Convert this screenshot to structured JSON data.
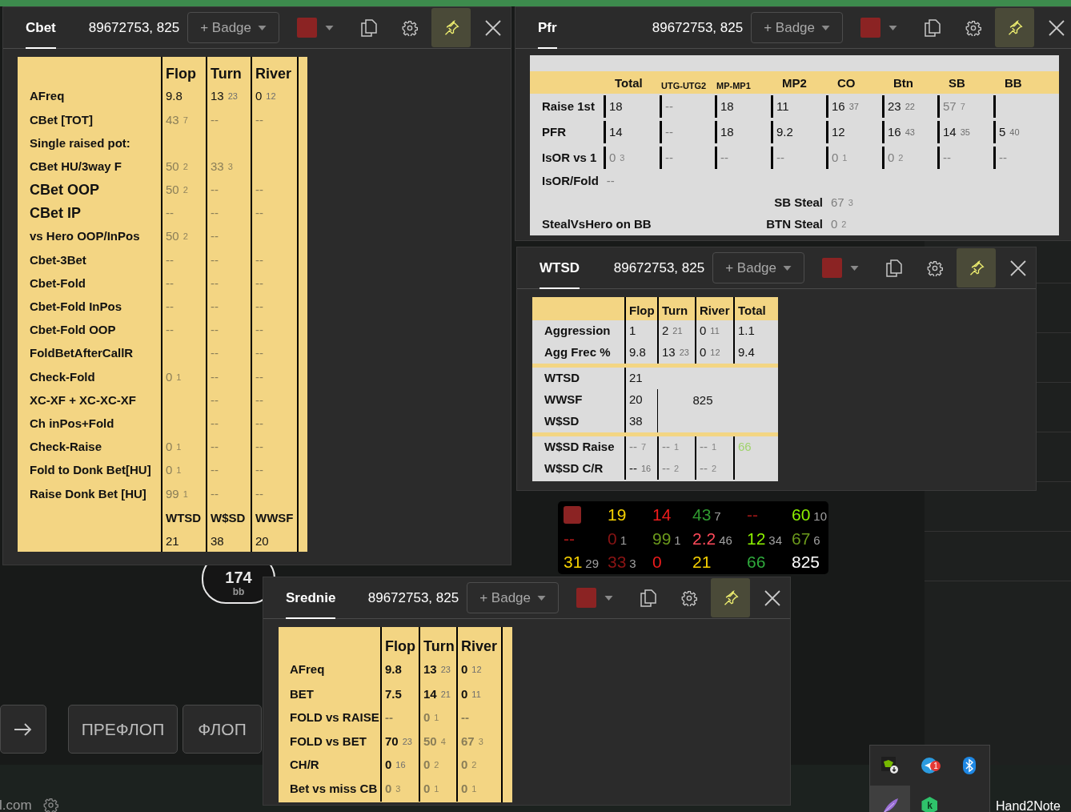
{
  "background": {
    "pot": {
      "value": "174",
      "unit": "bb"
    },
    "nav_buttons": [
      {
        "kind": "arrow"
      },
      {
        "kind": "text",
        "label": "ПРЕФЛОП"
      },
      {
        "kind": "text",
        "label": "ФЛОП"
      }
    ],
    "footer_text": "l.com"
  },
  "popups": [
    {
      "kind": "streets",
      "tab": {
        "label": "Cbet",
        "selected": true
      },
      "player": "89672753, 825",
      "badge_button": "+ Badge",
      "color": "#8b2323",
      "pinned": true,
      "columns": [
        "Flop",
        "Turn",
        "River"
      ],
      "rows": [
        {
          "label": "AFreq",
          "big": false,
          "cells": [
            {
              "v": "9.8",
              "dim": false
            },
            {
              "v": "13",
              "n": "23",
              "dim": false
            },
            {
              "v": "0",
              "n": "12",
              "dim": false
            }
          ]
        },
        {
          "label": "CBet [TOT]",
          "big": false,
          "cells": [
            {
              "v": "43",
              "n": "7",
              "dim": true
            },
            {
              "v": "--",
              "dim": true
            },
            {
              "v": "--",
              "dim": true
            }
          ]
        },
        {
          "label": "Single raised pot:",
          "big": false,
          "cells": [
            null,
            null,
            null
          ]
        },
        {
          "label": "CBet HU/3way F",
          "big": false,
          "cells": [
            {
              "v": "50",
              "n": "2",
              "dim": true
            },
            {
              "v": "33",
              "n": "3",
              "dim": true
            },
            null
          ]
        },
        {
          "label": "CBet OOP",
          "big": true,
          "cells": [
            {
              "v": "50",
              "n": "2",
              "dim": true
            },
            {
              "v": "--",
              "dim": true
            },
            {
              "v": "--",
              "dim": true
            }
          ]
        },
        {
          "label": "CBet IP",
          "big": true,
          "cells": [
            {
              "v": "--",
              "dim": true
            },
            {
              "v": "--",
              "dim": true
            },
            {
              "v": "--",
              "dim": true
            }
          ]
        },
        {
          "label": "vs Hero OOP/InPos",
          "big": false,
          "cells": [
            {
              "v": "50",
              "n": "2",
              "dim": true
            },
            {
              "v": "--",
              "dim": true
            },
            null
          ]
        },
        {
          "label": "Cbet-3Bet",
          "big": false,
          "cells": [
            {
              "v": "--",
              "dim": true
            },
            {
              "v": "--",
              "dim": true
            },
            {
              "v": "--",
              "dim": true
            }
          ]
        },
        {
          "label": "Cbet-Fold",
          "big": false,
          "cells": [
            {
              "v": "--",
              "dim": true
            },
            {
              "v": "--",
              "dim": true
            },
            {
              "v": "--",
              "dim": true
            }
          ]
        },
        {
          "label": "Cbet-Fold InPos",
          "big": false,
          "cells": [
            {
              "v": "--",
              "dim": true
            },
            {
              "v": "--",
              "dim": true
            },
            {
              "v": "--",
              "dim": true
            }
          ]
        },
        {
          "label": "Cbet-Fold OOP",
          "big": false,
          "cells": [
            {
              "v": "--",
              "dim": true
            },
            {
              "v": "--",
              "dim": true
            },
            {
              "v": "--",
              "dim": true
            }
          ]
        },
        {
          "label": "FoldBetAfterCallR",
          "big": false,
          "cells": [
            null,
            {
              "v": "--",
              "dim": true
            },
            {
              "v": "--",
              "dim": true
            }
          ]
        },
        {
          "label": "Check-Fold",
          "big": false,
          "cells": [
            {
              "v": "0",
              "n": "1",
              "dim": true
            },
            {
              "v": "--",
              "dim": true
            },
            {
              "v": "--",
              "dim": true
            }
          ]
        },
        {
          "label": "XC-XF + XC-XC-XF",
          "big": false,
          "cells": [
            null,
            {
              "v": "--",
              "dim": true
            },
            {
              "v": "--",
              "dim": true
            }
          ]
        },
        {
          "label": "Ch inPos+Fold",
          "big": false,
          "cells": [
            null,
            {
              "v": "--",
              "dim": true
            },
            {
              "v": "--",
              "dim": true
            }
          ]
        },
        {
          "label": "Check-Raise",
          "big": false,
          "cells": [
            {
              "v": "0",
              "n": "1",
              "dim": true
            },
            {
              "v": "--",
              "dim": true
            },
            {
              "v": "--",
              "dim": true
            }
          ]
        },
        {
          "label": "Fold to Donk Bet[HU]",
          "big": false,
          "cells": [
            {
              "v": "0",
              "n": "1",
              "dim": true
            },
            {
              "v": "--",
              "dim": true
            },
            {
              "v": "--",
              "dim": true
            }
          ]
        },
        {
          "label": "Raise Donk Bet [HU]",
          "big": false,
          "cells": [
            {
              "v": "99",
              "n": "1",
              "dim": true
            },
            {
              "v": "--",
              "dim": true
            },
            {
              "v": "--",
              "dim": true
            }
          ]
        }
      ],
      "footer": {
        "headers": [
          "WTSD",
          "W$SD",
          "WWSF"
        ],
        "values": [
          "21",
          "38",
          "20"
        ]
      }
    },
    {
      "kind": "positions",
      "tab": {
        "label": "Pfr",
        "selected": true
      },
      "player": "89672753, 825",
      "badge_button": "+ Badge",
      "color": "#8b2323",
      "pinned": true,
      "columns": [
        {
          "label": "Total",
          "small": false
        },
        {
          "label": "UTG-UTG2",
          "small": true
        },
        {
          "label": "MP-MP1",
          "small": true
        },
        {
          "label": "MP2",
          "small": false
        },
        {
          "label": "CO",
          "small": false
        },
        {
          "label": "Btn",
          "small": false
        },
        {
          "label": "SB",
          "small": false
        },
        {
          "label": "BB",
          "small": false
        }
      ],
      "rows": [
        {
          "label": "Raise 1st",
          "cells": [
            {
              "v": "18",
              "dim": false
            },
            {
              "v": "--",
              "dim": true
            },
            {
              "v": "18",
              "dim": false
            },
            {
              "v": "11",
              "dim": false
            },
            {
              "v": "16",
              "n": "37",
              "dim": false
            },
            {
              "v": "23",
              "n": "22",
              "dim": false
            },
            {
              "v": "57",
              "n": "7",
              "dim": true
            },
            null
          ]
        },
        {
          "label": "PFR",
          "cells": [
            {
              "v": "14",
              "dim": false
            },
            {
              "v": "--",
              "dim": true
            },
            {
              "v": "18",
              "dim": false
            },
            {
              "v": "9.2",
              "dim": false
            },
            {
              "v": "12",
              "dim": false
            },
            {
              "v": "16",
              "n": "43",
              "dim": false
            },
            {
              "v": "14",
              "n": "35",
              "dim": false
            },
            {
              "v": "5",
              "n": "40",
              "dim": false
            }
          ]
        },
        {
          "label": "IsOR vs 1",
          "cells": [
            {
              "v": "0",
              "n": "3",
              "dim": true
            },
            {
              "v": "--",
              "dim": true
            },
            {
              "v": "--",
              "dim": true
            },
            {
              "v": "--",
              "dim": true
            },
            {
              "v": "0",
              "n": "1",
              "dim": true
            },
            {
              "v": "0",
              "n": "2",
              "dim": true
            },
            {
              "v": "--",
              "dim": true
            },
            {
              "v": "--",
              "dim": true
            }
          ]
        }
      ],
      "extra_lines": [
        {
          "left": {
            "label": "IsOR/Fold",
            "cell": {
              "v": "--",
              "dim": true
            }
          }
        },
        {
          "right": {
            "label": "SB Steal",
            "cell": {
              "v": "67",
              "n": "3",
              "dim": true
            }
          }
        },
        {
          "left": {
            "label": "StealVsHero on BB"
          },
          "right": {
            "label": "BTN Steal",
            "cell": {
              "v": "0",
              "n": "2",
              "dim": true
            }
          }
        }
      ]
    },
    {
      "kind": "showdown",
      "tab": {
        "label": "WTSD",
        "selected": true
      },
      "player": "89672753, 825",
      "badge_button": "+ Badge",
      "color": "#8b2323",
      "pinned": true,
      "columns": [
        "Flop",
        "Turn",
        "River",
        "Total"
      ],
      "sections": [
        {
          "kind": "grid",
          "rows": [
            {
              "label": "Aggression",
              "cells": [
                {
                  "v": "1",
                  "dim": false
                },
                {
                  "v": "2",
                  "n": "21",
                  "dim": false
                },
                {
                  "v": "0",
                  "n": "11",
                  "dim": false
                },
                {
                  "v": "1.1",
                  "dim": false
                }
              ]
            },
            {
              "label": "Agg Frec %",
              "cells": [
                {
                  "v": "9.8",
                  "dim": false
                },
                {
                  "v": "13",
                  "n": "23",
                  "dim": false
                },
                {
                  "v": "0",
                  "n": "12",
                  "dim": false
                },
                {
                  "v": "9.4",
                  "dim": false
                }
              ]
            }
          ]
        },
        {
          "kind": "summary",
          "rows": [
            {
              "label": "WTSD",
              "cells": [
                {
                  "v": "21",
                  "dim": false
                }
              ]
            },
            {
              "label": "WWSF",
              "cells": [
                {
                  "v": "20",
                  "dim": false
                }
              ],
              "note": "825"
            },
            {
              "label": "W$SD",
              "cells": [
                {
                  "v": "38",
                  "dim": false
                }
              ]
            }
          ]
        },
        {
          "kind": "grid",
          "rows": [
            {
              "label": "W$SD Raise",
              "cells": [
                {
                  "v": "--",
                  "n": "7",
                  "dim": true
                },
                {
                  "v": "--",
                  "n": "1",
                  "dim": true
                },
                {
                  "v": "--",
                  "n": "1",
                  "dim": true
                },
                {
                  "v": "66",
                  "color": "#9fd36c"
                }
              ]
            },
            {
              "label": "W$SD C/R",
              "cells": [
                {
                  "v": "--",
                  "n": "16",
                  "dim": false
                },
                {
                  "v": "--",
                  "n": "2",
                  "dim": true
                },
                {
                  "v": "--",
                  "n": "2",
                  "dim": true
                },
                null
              ]
            }
          ]
        }
      ]
    },
    {
      "kind": "streets_bold",
      "tab": {
        "label": "Srednie",
        "selected": true
      },
      "player": "89672753, 825",
      "badge_button": "+ Badge",
      "color": "#8b2323",
      "pinned": true,
      "columns": [
        "Flop",
        "Turn",
        "River"
      ],
      "rows": [
        {
          "label": "AFreq",
          "cells": [
            {
              "v": "9.8",
              "dim": false
            },
            {
              "v": "13",
              "n": "23",
              "dim": false
            },
            {
              "v": "0",
              "n": "12",
              "dim": false
            }
          ]
        },
        {
          "label": "BET",
          "cells": [
            {
              "v": "7.5",
              "dim": false
            },
            {
              "v": "14",
              "n": "21",
              "dim": false
            },
            {
              "v": "0",
              "n": "11",
              "dim": false
            }
          ]
        },
        {
          "label": "FOLD vs RAISE",
          "cells": [
            {
              "v": "--",
              "dim": true
            },
            {
              "v": "0",
              "n": "1",
              "dim": true
            },
            {
              "v": "--",
              "dim": true
            }
          ]
        },
        {
          "label": "FOLD vs BET",
          "cells": [
            {
              "v": "70",
              "n": "23",
              "dim": false
            },
            {
              "v": "50",
              "n": "4",
              "dim": true
            },
            {
              "v": "67",
              "n": "3",
              "dim": true
            }
          ]
        },
        {
          "label": "CH/R",
          "cells": [
            {
              "v": "0",
              "n": "16",
              "dim": false
            },
            {
              "v": "0",
              "n": "2",
              "dim": true
            },
            {
              "v": "0",
              "n": "2",
              "dim": true
            }
          ]
        },
        {
          "label": "Bet vs miss CB",
          "cells": [
            {
              "v": "0",
              "n": "3",
              "dim": true
            },
            {
              "v": "0",
              "n": "1",
              "dim": true
            },
            {
              "v": "0",
              "n": "1",
              "dim": true
            }
          ]
        }
      ]
    }
  ],
  "hud": {
    "rows": [
      [
        {
          "kind": "swatch",
          "color": "#8b2323"
        },
        {
          "kind": "stat",
          "v": "19",
          "color": "#f5d000"
        },
        {
          "kind": "stat",
          "v": "14",
          "color": "#ee1c1c"
        },
        {
          "kind": "stat",
          "v": "43",
          "n": "7",
          "color": "#2f9a2f"
        },
        {
          "kind": "stat",
          "v": "--",
          "color": "#a01818"
        },
        {
          "kind": "stat",
          "v": "60",
          "n": "10",
          "color": "#8cf000"
        }
      ],
      [
        {
          "kind": "stat",
          "v": "--",
          "color": "#b01818"
        },
        {
          "kind": "stat",
          "v": "0",
          "n": "1",
          "color": "#8a1414"
        },
        {
          "kind": "stat",
          "v": "99",
          "n": "1",
          "color": "#6c9a1c"
        },
        {
          "kind": "stat",
          "v": "2.2",
          "n": "46",
          "color": "#ff4a5a"
        },
        {
          "kind": "stat",
          "v": "12",
          "n": "34",
          "color": "#8cf000"
        },
        {
          "kind": "stat",
          "v": "67",
          "n": "6",
          "color": "#6c9a1c"
        }
      ],
      [
        {
          "kind": "stat",
          "v": "31",
          "n": "29",
          "color": "#f5d000"
        },
        {
          "kind": "stat",
          "v": "33",
          "n": "3",
          "color": "#8a1414"
        },
        {
          "kind": "stat",
          "v": "0",
          "color": "#ee1c1c"
        },
        {
          "kind": "stat",
          "v": "21",
          "color": "#f5d000"
        },
        {
          "kind": "stat",
          "v": "66",
          "color": "#2faa3c"
        },
        {
          "kind": "stat",
          "v": "825",
          "color": "#ffffff"
        }
      ]
    ]
  },
  "tray": {
    "items": [
      {
        "kind": "chip",
        "selected": false
      },
      {
        "kind": "plane",
        "badge": "1",
        "selected": false
      },
      {
        "kind": "bluetooth",
        "selected": false
      },
      {
        "kind": "feather",
        "selected": true
      },
      {
        "kind": "hexagon",
        "label": "k",
        "selected": false
      }
    ],
    "taskbar_label": "Hand2Note"
  }
}
